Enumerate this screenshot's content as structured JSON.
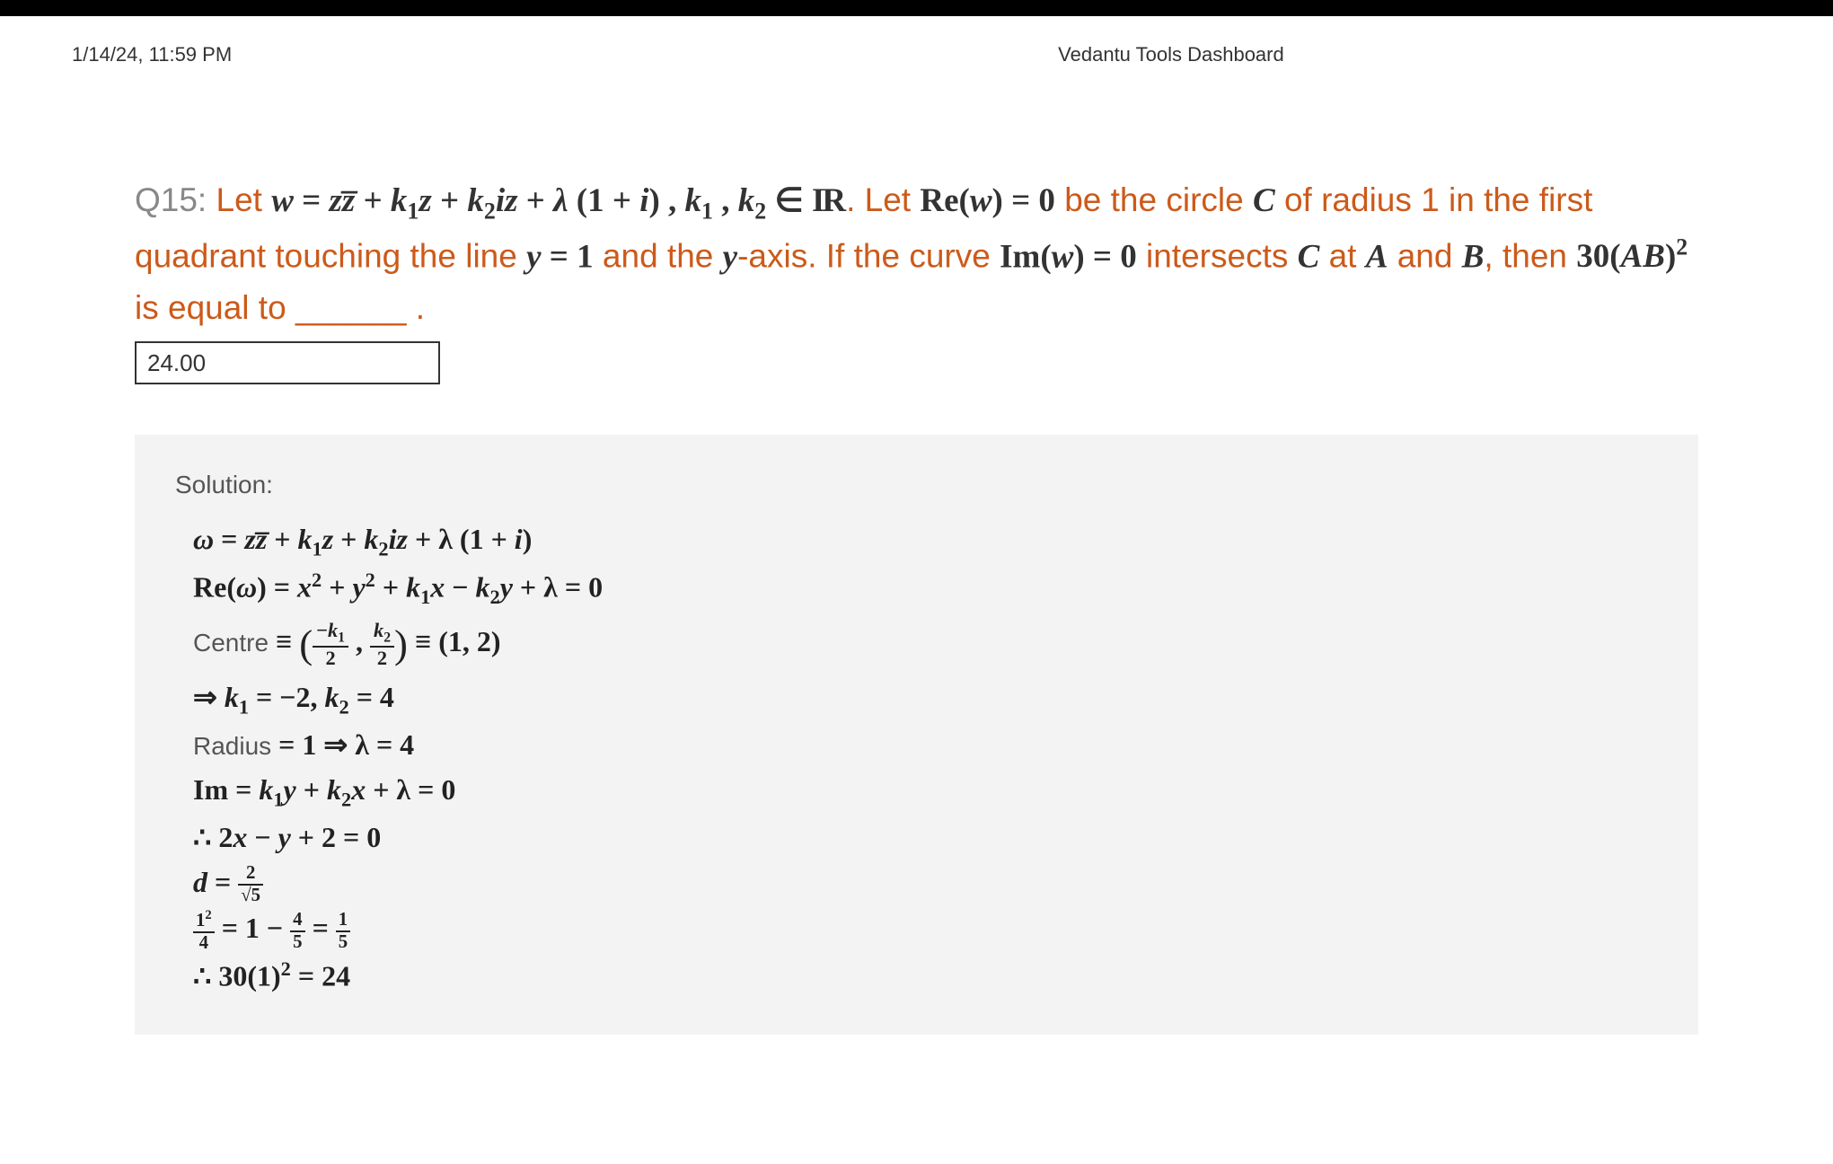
{
  "header": {
    "timestamp": "1/14/24, 11:59 PM",
    "title": "Vedantu Tools Dashboard"
  },
  "question": {
    "label": "Q15:",
    "text_parts": {
      "p1": " Let ",
      "eq1_lhs": "w",
      "eq1_op": " = ",
      "eq1_t1": "z",
      "eq1_t1b": "z̅",
      "eq1_plus1": " + ",
      "eq1_k1": "k",
      "eq1_k1sub": "1",
      "eq1_k1z": "z",
      "eq1_plus2": " + ",
      "eq1_k2": "k",
      "eq1_k2sub": "2",
      "eq1_k2iz": "iz",
      "eq1_plus3": " + ",
      "eq1_lambda": "λ",
      "eq1_paren": "(1 + ",
      "eq1_i": "i",
      "eq1_close": ") , ",
      "k1k2": "k",
      "k1sub": "1",
      "comma": " , ",
      "k2": "k",
      "k2sub": "2",
      "in": " ∈ ",
      "R1": "I",
      "R2": "R",
      "p2": ". Let ",
      "re": "Re(",
      "rew": "w",
      "reclose": ") = 0",
      "p3": " be the circle ",
      "C": "C",
      "p4": " of radius 1 in the first quadrant touching the line ",
      "y1": "y",
      "y1eq": " = 1",
      "p5": " and the ",
      "yaxis": "y",
      "p6": "-axis. If the curve ",
      "im": "Im(",
      "imw": "w",
      "imclose": ") = 0",
      "p7": " intersects ",
      "C2": "C",
      "p8": " at ",
      "A": "A",
      "p9": " and ",
      "B": "B",
      "p10": ", then ",
      "thirty": "30(",
      "AB": "AB",
      "sq": "2",
      "p11": " is equal to ______ .",
      "close_paren": ")"
    },
    "answer": "24.00"
  },
  "solution": {
    "label": "Solution:",
    "lines": {
      "l1": {
        "w": "ω",
        "eq": " = ",
        "z": "z",
        "zbar": "z̅",
        "p1": " + ",
        "k": "k",
        "s1": "1",
        "z2": "z",
        "p2": " + ",
        "k2": "k",
        "s2": "2",
        "iz": "iz",
        "p3": " + λ (1 + ",
        "i": "i",
        "cl": ")"
      },
      "l2": {
        "re": "Re(",
        "w": "ω",
        "cl": ") = ",
        "x": "x",
        "sq": "2",
        "p1": " + ",
        "y": "y",
        "sq2": "2",
        "p2": " + ",
        "k": "k",
        "s1": "1",
        "x2": "x",
        "p3": " − ",
        "k2": "k",
        "s2": "2",
        "y2": "y",
        "p4": " + λ = 0"
      },
      "l3": {
        "centre": "Centre",
        "eq": " ≡ ",
        "num1_a": "−",
        "num1_b": "k",
        "num1_c": "1",
        "den1": "2",
        "comma": " , ",
        "num2_a": "k",
        "num2_b": "2",
        "den2": "2",
        "eq2": " ≡ (1, 2)"
      },
      "l4": {
        "arr": "⇒ ",
        "k": "k",
        "s1": "1",
        "eq1": " = −2,  ",
        "k2": "k",
        "s2": "2",
        "eq2": " = 4"
      },
      "l5": {
        "rad": "Radius",
        "eq": " = 1 ⇒ λ = 4"
      },
      "l6": {
        "im": "Im = ",
        "k": "k",
        "s1": "1",
        "y": "y",
        "p1": " + ",
        "k2": "k",
        "s2": "2",
        "x": "x",
        "p2": " + λ = 0"
      },
      "l7": {
        "th": "∴  2",
        "x": "x",
        "p1": " − ",
        "y": "y",
        "p2": " + 2 = 0"
      },
      "l8": {
        "d": "d",
        "eq": " = ",
        "num": "2",
        "den": "√5"
      },
      "l9": {
        "num1_a": "1",
        "num1_b": "2",
        "den1": "4",
        "eq": " = 1 − ",
        "num2": "4",
        "den2": "5",
        "eq2": " = ",
        "num3": "1",
        "den3": "5"
      },
      "l10": {
        "th": "∴  30(1)",
        "sq": "2",
        "eq": " = 24"
      }
    }
  }
}
